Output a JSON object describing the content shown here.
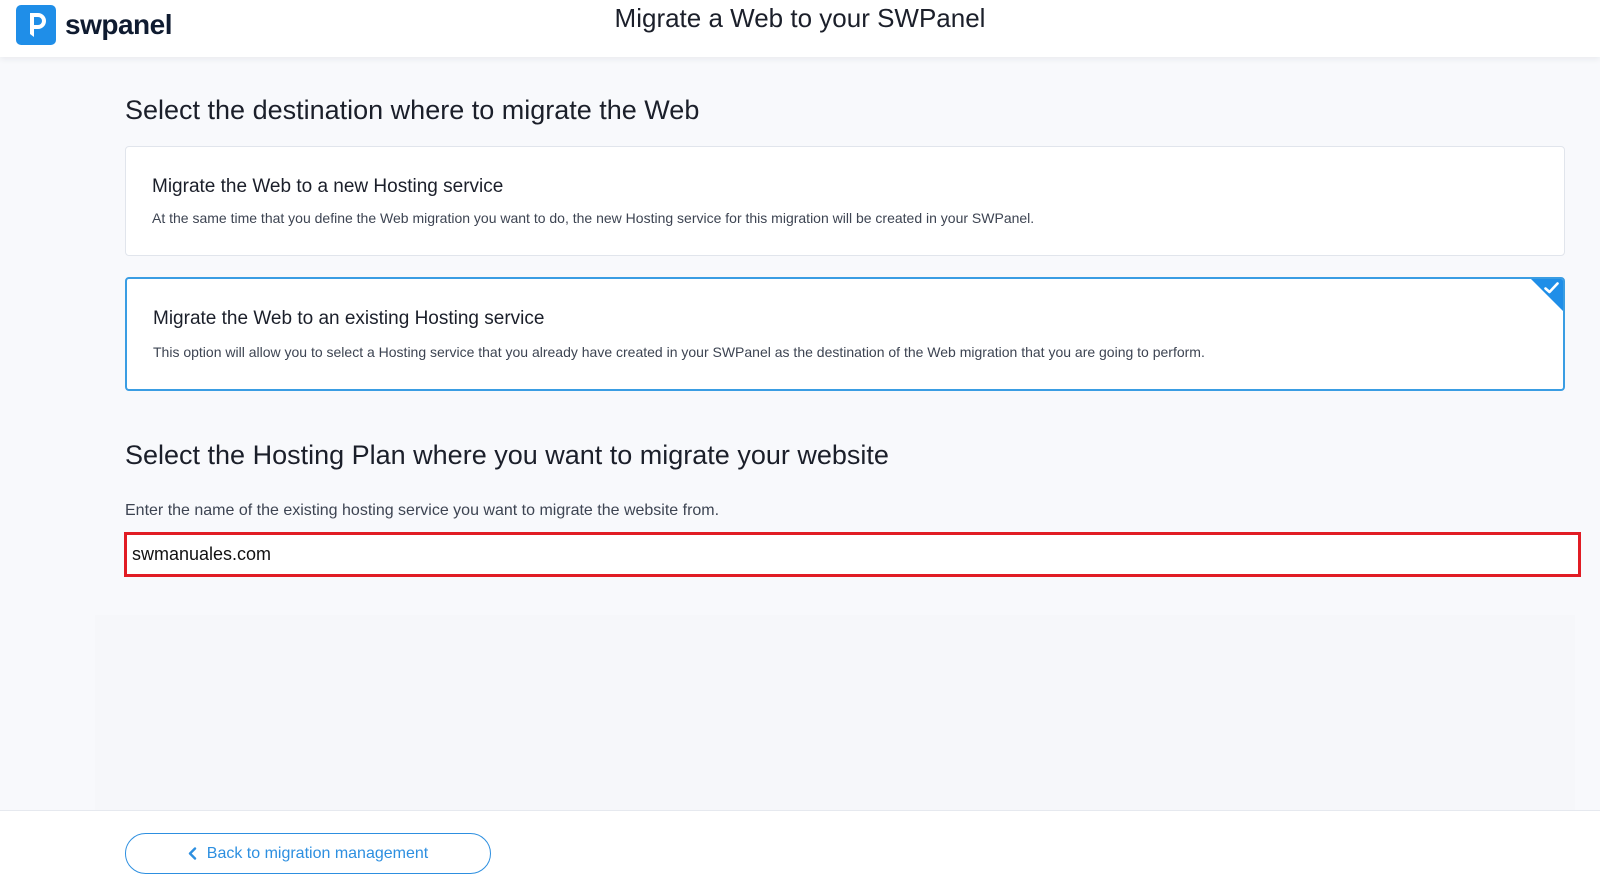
{
  "brand": {
    "name": "swpanel",
    "color": "#1f8ee8",
    "icon": "swpanel-logo-icon"
  },
  "header": {
    "title": "Migrate a Web to your SWPanel"
  },
  "destination": {
    "heading": "Select the destination where to migrate the Web",
    "options": [
      {
        "title": "Migrate the Web to a new Hosting service",
        "description": "At the same time that you define the Web migration you want to do, the new Hosting service for this migration will be created in your SWPanel.",
        "selected": false
      },
      {
        "title": "Migrate the Web to an existing Hosting service",
        "description": "This option will allow you to select a Hosting service that you already have created in your SWPanel as the destination of the Web migration that you are going to perform.",
        "selected": true
      }
    ]
  },
  "hosting_plan": {
    "heading": "Select the Hosting Plan where you want to migrate your website",
    "label": "Enter the name of the existing hosting service you want to migrate the website from.",
    "value": "swmanuales.com",
    "highlight_color": "#e11c24"
  },
  "footer": {
    "back_label": "Back to migration management",
    "back_icon": "chevron-left-icon"
  },
  "colors": {
    "accent": "#1f8ee8",
    "selected_border": "#3a9de3"
  }
}
